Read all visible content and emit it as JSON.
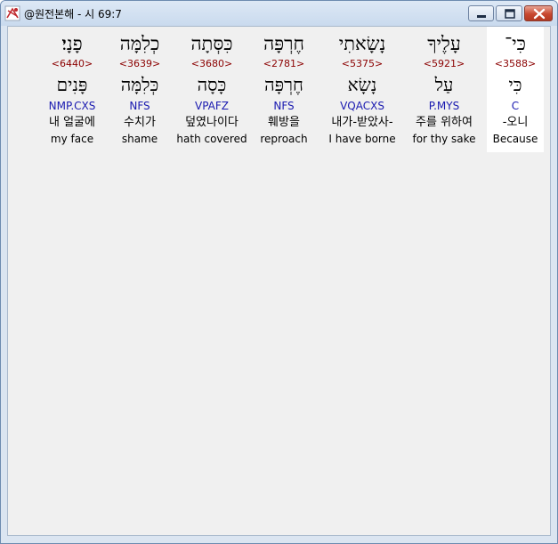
{
  "window": {
    "title": "@원전본해 - 시 69:7",
    "icon": "bible-app-icon",
    "controls": {
      "minimize": "minimize-icon",
      "maximize": "maximize-icon",
      "close": "close-icon"
    }
  },
  "interlinear": {
    "selected_index": 0,
    "words": [
      {
        "hebrew": "כִּי־",
        "strongs": "<3588>",
        "root": "כִּי",
        "morph": "C",
        "korean": "-오니",
        "english": "Because"
      },
      {
        "hebrew": "עָלֶיךָ",
        "strongs": "<5921>",
        "root": "עַל",
        "morph": "P.MYS",
        "korean": "주를 위하여",
        "english": "for thy sake"
      },
      {
        "hebrew": "נָשָׂאתִי",
        "strongs": "<5375>",
        "root": "נָשָׂא",
        "morph": "VQACXS",
        "korean": "내가-받았사-",
        "english": "I have borne"
      },
      {
        "hebrew": "חֶרְפָּה",
        "strongs": "<2781>",
        "root": "חֶרְפָּה",
        "morph": "NFS",
        "korean": "훼방을",
        "english": "reproach"
      },
      {
        "hebrew": "כִּסְּתָה",
        "strongs": "<3680>",
        "root": "כָּסָה",
        "morph": "VPAFZ",
        "korean": "덮였나이다",
        "english": "hath covered"
      },
      {
        "hebrew": "כְלִמָּה",
        "strongs": "<3639>",
        "root": "כְּלִמָּה",
        "morph": "NFS",
        "korean": "수치가",
        "english": "shame"
      },
      {
        "hebrew": "פָנָי׃",
        "strongs": "<6440>",
        "root": "פָּנִים",
        "morph": "NMP.CXS",
        "korean": "내 얼굴에",
        "english": "my face"
      }
    ]
  }
}
